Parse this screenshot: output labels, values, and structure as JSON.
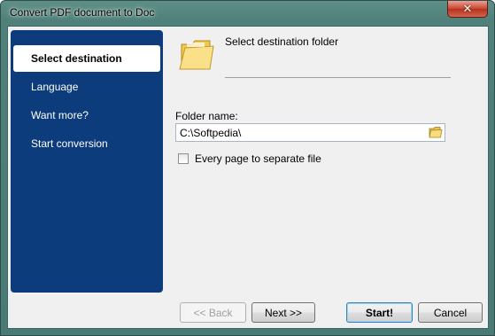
{
  "window": {
    "title": "Convert PDF document to Doc"
  },
  "sidebar": {
    "items": [
      {
        "label": "Select destination"
      },
      {
        "label": "Language"
      },
      {
        "label": "Want more?"
      },
      {
        "label": "Start conversion"
      }
    ]
  },
  "main": {
    "heading": "Select destination folder",
    "folder_label": "Folder name:",
    "folder_value": "C:\\Softpedia\\",
    "checkbox_label": "Every page to separate file",
    "checkbox_checked": false
  },
  "buttons": {
    "back": "<< Back",
    "next": "Next >>",
    "start": "Start!",
    "cancel": "Cancel"
  },
  "colors": {
    "sidebar_bg": "#0d3c7c",
    "window_frame": "#4f807a"
  },
  "icons": {
    "close": "close-icon",
    "header": "folder-icon",
    "browse": "browse-folder-icon"
  }
}
